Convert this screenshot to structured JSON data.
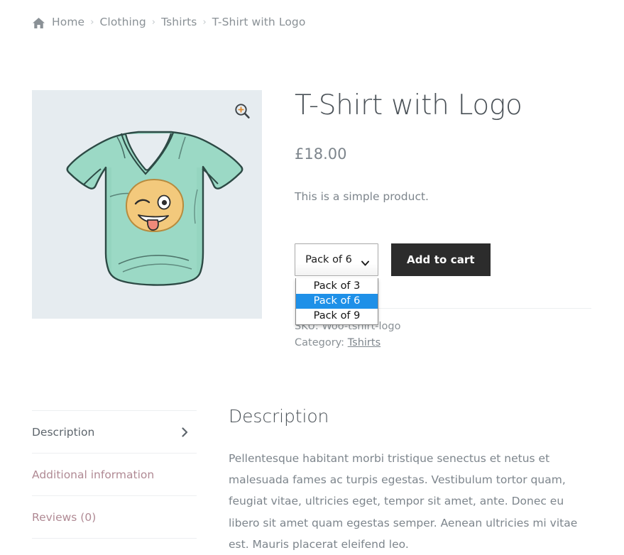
{
  "breadcrumb": {
    "home_icon": "home-icon",
    "separator": "›",
    "items": [
      {
        "label": "Home",
        "current": false
      },
      {
        "label": "Clothing",
        "current": false
      },
      {
        "label": "Tshirts",
        "current": false
      },
      {
        "label": "T-Shirt with Logo",
        "current": true
      }
    ]
  },
  "gallery": {
    "zoom_icon": "zoom-in-icon",
    "image_alt": "mint green v-neck t-shirt with winking emoji logo",
    "background_color": "#e6ecf0",
    "shirt_color": "#9fdcc8",
    "logo_color": "#f2c777"
  },
  "summary": {
    "title": "T-Shirt with Logo",
    "price": "£18.00",
    "short_description": "This is a simple product."
  },
  "cart_form": {
    "select": {
      "name": "pack-size-select",
      "value": "Pack of 6",
      "expanded": true,
      "caret_icon": "chevron-down-icon",
      "options": [
        {
          "label": "Pack of 3",
          "selected": false
        },
        {
          "label": "Pack of 6",
          "selected": true
        },
        {
          "label": "Pack of 9",
          "selected": false
        }
      ],
      "highlight_color": "#1e90e8"
    },
    "add_to_cart_label": "Add to cart",
    "add_to_cart_bg": "#2c2c2c"
  },
  "meta": {
    "sku_label": "SKU:",
    "sku_value": "Woo-tshirt-logo",
    "category_label": "Category:",
    "category_value": "Tshirts"
  },
  "tabs": [
    {
      "label": "Description",
      "active": true,
      "chevron_icon": "chevron-right-icon"
    },
    {
      "label": "Additional information",
      "active": false
    },
    {
      "label": "Reviews (0)",
      "active": false
    }
  ],
  "panel": {
    "title": "Description",
    "body": "Pellentesque habitant morbi tristique senectus et netus et malesuada fames ac turpis egestas. Vestibulum tortor quam, feugiat vitae, ultricies eget, tempor sit amet, ante. Donec eu libero sit amet quam egestas semper. Aenean ultricies mi vitae est. Mauris placerat eleifend leo."
  }
}
